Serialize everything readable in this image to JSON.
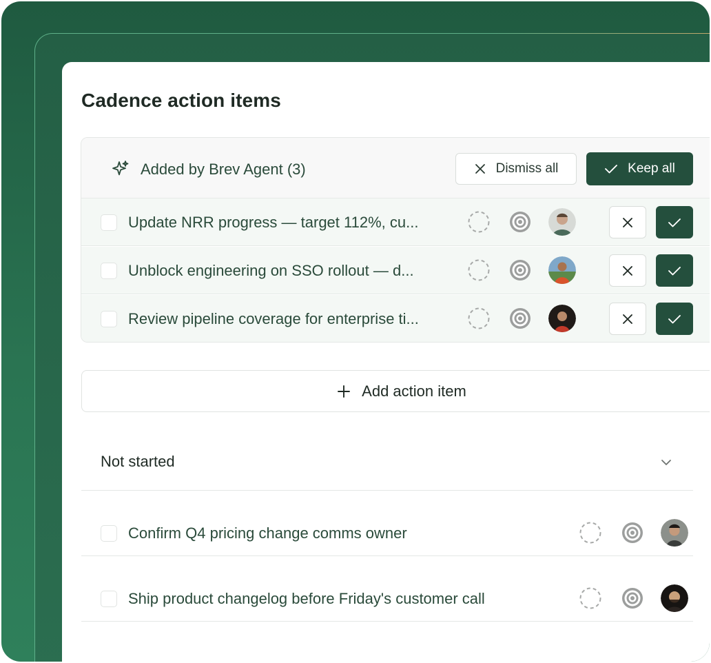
{
  "title": "Cadence action items",
  "agent_section": {
    "label": "Added by Brev Agent (3)",
    "dismiss_all_label": "Dismiss all",
    "keep_all_label": "Keep all",
    "items": [
      {
        "text": "Update NRR progress — target 112%, cu...",
        "avatar_color": "#c9a48c"
      },
      {
        "text": "Unblock engineering on SSO rollout — d...",
        "avatar_color": "#d9532b"
      },
      {
        "text": "Review pipeline coverage for enterprise ti...",
        "avatar_color": "#1f1a17"
      }
    ]
  },
  "add_item_label": "Add action item",
  "not_started": {
    "label": "Not started",
    "items": [
      {
        "text": "Confirm Q4 pricing change comms owner",
        "avatar_color": "#6b6f6a"
      },
      {
        "text": "Ship product changelog before Friday's customer call",
        "avatar_color": "#2a2320"
      }
    ]
  },
  "colors": {
    "brand_dark": "#244f3d",
    "frame_green": "#2a7452",
    "text_green": "#2a4a3a"
  }
}
